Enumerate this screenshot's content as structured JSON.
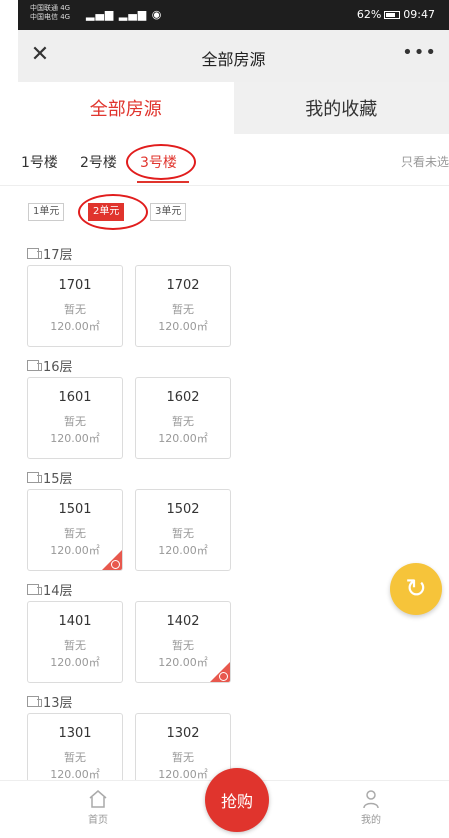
{
  "status_bar": {
    "carrier_line1": "中国联通 4G",
    "carrier_line2": "中国电信 4G",
    "battery": "62%",
    "time": "09:47"
  },
  "nav": {
    "close_icon": "close-icon",
    "title": "全部房源",
    "more_icon": "more-icon"
  },
  "main_tabs": [
    {
      "label": "全部房源",
      "active": true
    },
    {
      "label": "我的收藏",
      "active": false
    }
  ],
  "building_tabs": [
    {
      "label": "1号楼"
    },
    {
      "label": "2号楼"
    },
    {
      "label": "3号楼",
      "active": true
    }
  ],
  "filter_link": "只看未选",
  "unit_tabs": [
    {
      "label": "1单元"
    },
    {
      "label": "2单元",
      "active": true
    },
    {
      "label": "3单元"
    }
  ],
  "floors": [
    {
      "label": "17层",
      "rooms": [
        {
          "no": "1701",
          "status": "暂无",
          "area": "120.00㎡"
        },
        {
          "no": "1702",
          "status": "暂无",
          "area": "120.00㎡"
        }
      ]
    },
    {
      "label": "16层",
      "rooms": [
        {
          "no": "1601",
          "status": "暂无",
          "area": "120.00㎡"
        },
        {
          "no": "1602",
          "status": "暂无",
          "area": "120.00㎡"
        }
      ]
    },
    {
      "label": "15层",
      "rooms": [
        {
          "no": "1501",
          "status": "暂无",
          "area": "120.00㎡",
          "favorited": true
        },
        {
          "no": "1502",
          "status": "暂无",
          "area": "120.00㎡"
        }
      ]
    },
    {
      "label": "14层",
      "rooms": [
        {
          "no": "1401",
          "status": "暂无",
          "area": "120.00㎡"
        },
        {
          "no": "1402",
          "status": "暂无",
          "area": "120.00㎡",
          "favorited": true
        }
      ]
    },
    {
      "label": "13层",
      "rooms": [
        {
          "no": "1301",
          "status": "暂无",
          "area": "120.00㎡"
        },
        {
          "no": "1302",
          "status": "暂无",
          "area": "120.00㎡"
        }
      ]
    }
  ],
  "refresh_icon": "refresh-icon",
  "bottom_bar": {
    "home_label": "首页",
    "buy_label": "抢购",
    "mine_label": "我的"
  },
  "colors": {
    "accent": "#e0342d",
    "refresh": "#f6c43a",
    "highlight_circle": "#e11d1d"
  }
}
